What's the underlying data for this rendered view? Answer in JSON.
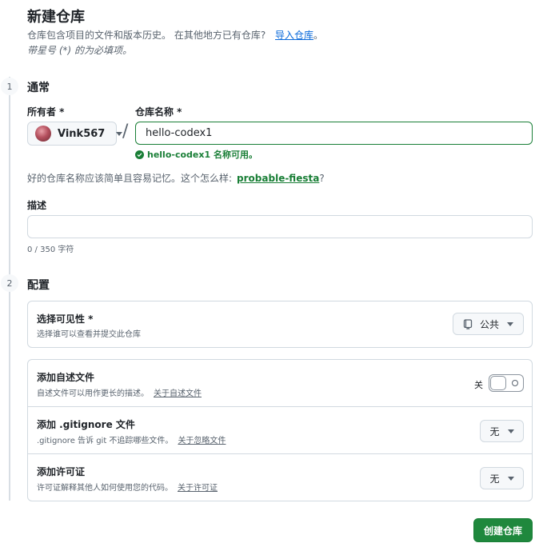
{
  "header": {
    "title": "新建仓库",
    "subtitle_text": "仓库包含项目的文件和版本历史。 在其他地方已有仓库?",
    "import_link": "导入仓库",
    "subtitle_end": "。",
    "required_note": "带星号 (*) 的为必填项。"
  },
  "steps": {
    "step1": {
      "number": "1",
      "title": "通常"
    },
    "step2": {
      "number": "2",
      "title": "配置"
    }
  },
  "owner": {
    "label": "所有者 *",
    "value": "Vink567"
  },
  "repo_name": {
    "label": "仓库名称 *",
    "value": "hello-codex1",
    "availability": "hello-codex1 名称可用。"
  },
  "suggestion": {
    "text": "好的仓库名称应该简单且容易记忆。这个怎么样:",
    "name": "probable-fiesta",
    "end": "?"
  },
  "description": {
    "label": "描述",
    "value": "",
    "char_count": "0 / 350 字符"
  },
  "visibility": {
    "title": "选择可见性 *",
    "desc": "选择谁可以查看并提交此仓库",
    "selected": "公共"
  },
  "readme": {
    "title": "添加自述文件",
    "desc": "自述文件可以用作更长的描述。",
    "link": "关于自述文件",
    "toggle_label": "关"
  },
  "gitignore": {
    "title": "添加 .gitignore 文件",
    "desc": ".gitignore 告诉 git 不追踪哪些文件。",
    "link": "关于忽略文件",
    "selected": "无"
  },
  "license": {
    "title": "添加许可证",
    "desc": "许可证解释其他人如何使用您的代码。",
    "link": "关于许可证",
    "selected": "无"
  },
  "submit": {
    "label": "创建仓库"
  },
  "colors": {
    "success_green": "#1a7f37",
    "primary_button": "#1f883d",
    "link_blue": "#0969da",
    "muted_text": "#59636e",
    "border": "#d1d9e0"
  }
}
